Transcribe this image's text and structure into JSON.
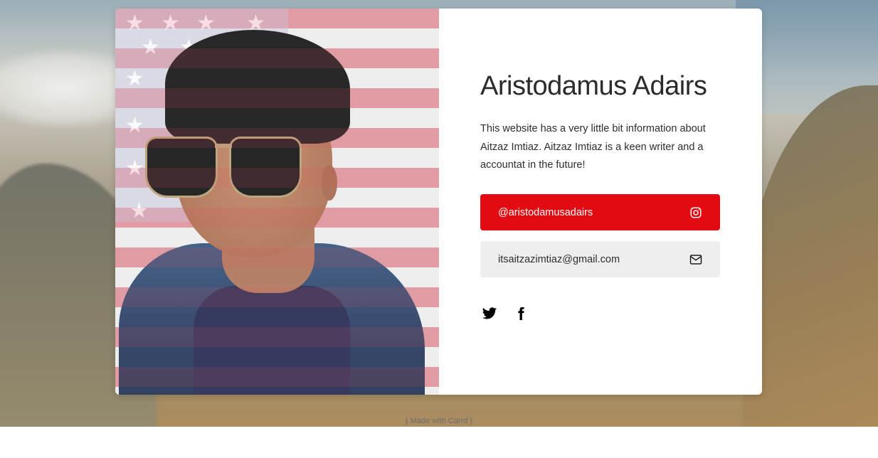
{
  "profile": {
    "name": "Aristodamus Adairs",
    "bio": "This website has a very little bit information about Aitzaz Imtiaz. Aitzaz Imtiaz is a keen writer and a accountat in the future!"
  },
  "buttons": {
    "instagram": {
      "label": "@aristodamusadairs",
      "icon": "instagram-icon",
      "color": "#e40a12"
    },
    "email": {
      "label": "itsaitzazimtiaz@gmail.com",
      "icon": "envelope-icon",
      "color": "#eeeeee"
    }
  },
  "socials": [
    {
      "icon": "twitter-icon"
    },
    {
      "icon": "facebook-icon"
    }
  ],
  "footer": {
    "text": "( Made with Carrd )"
  }
}
